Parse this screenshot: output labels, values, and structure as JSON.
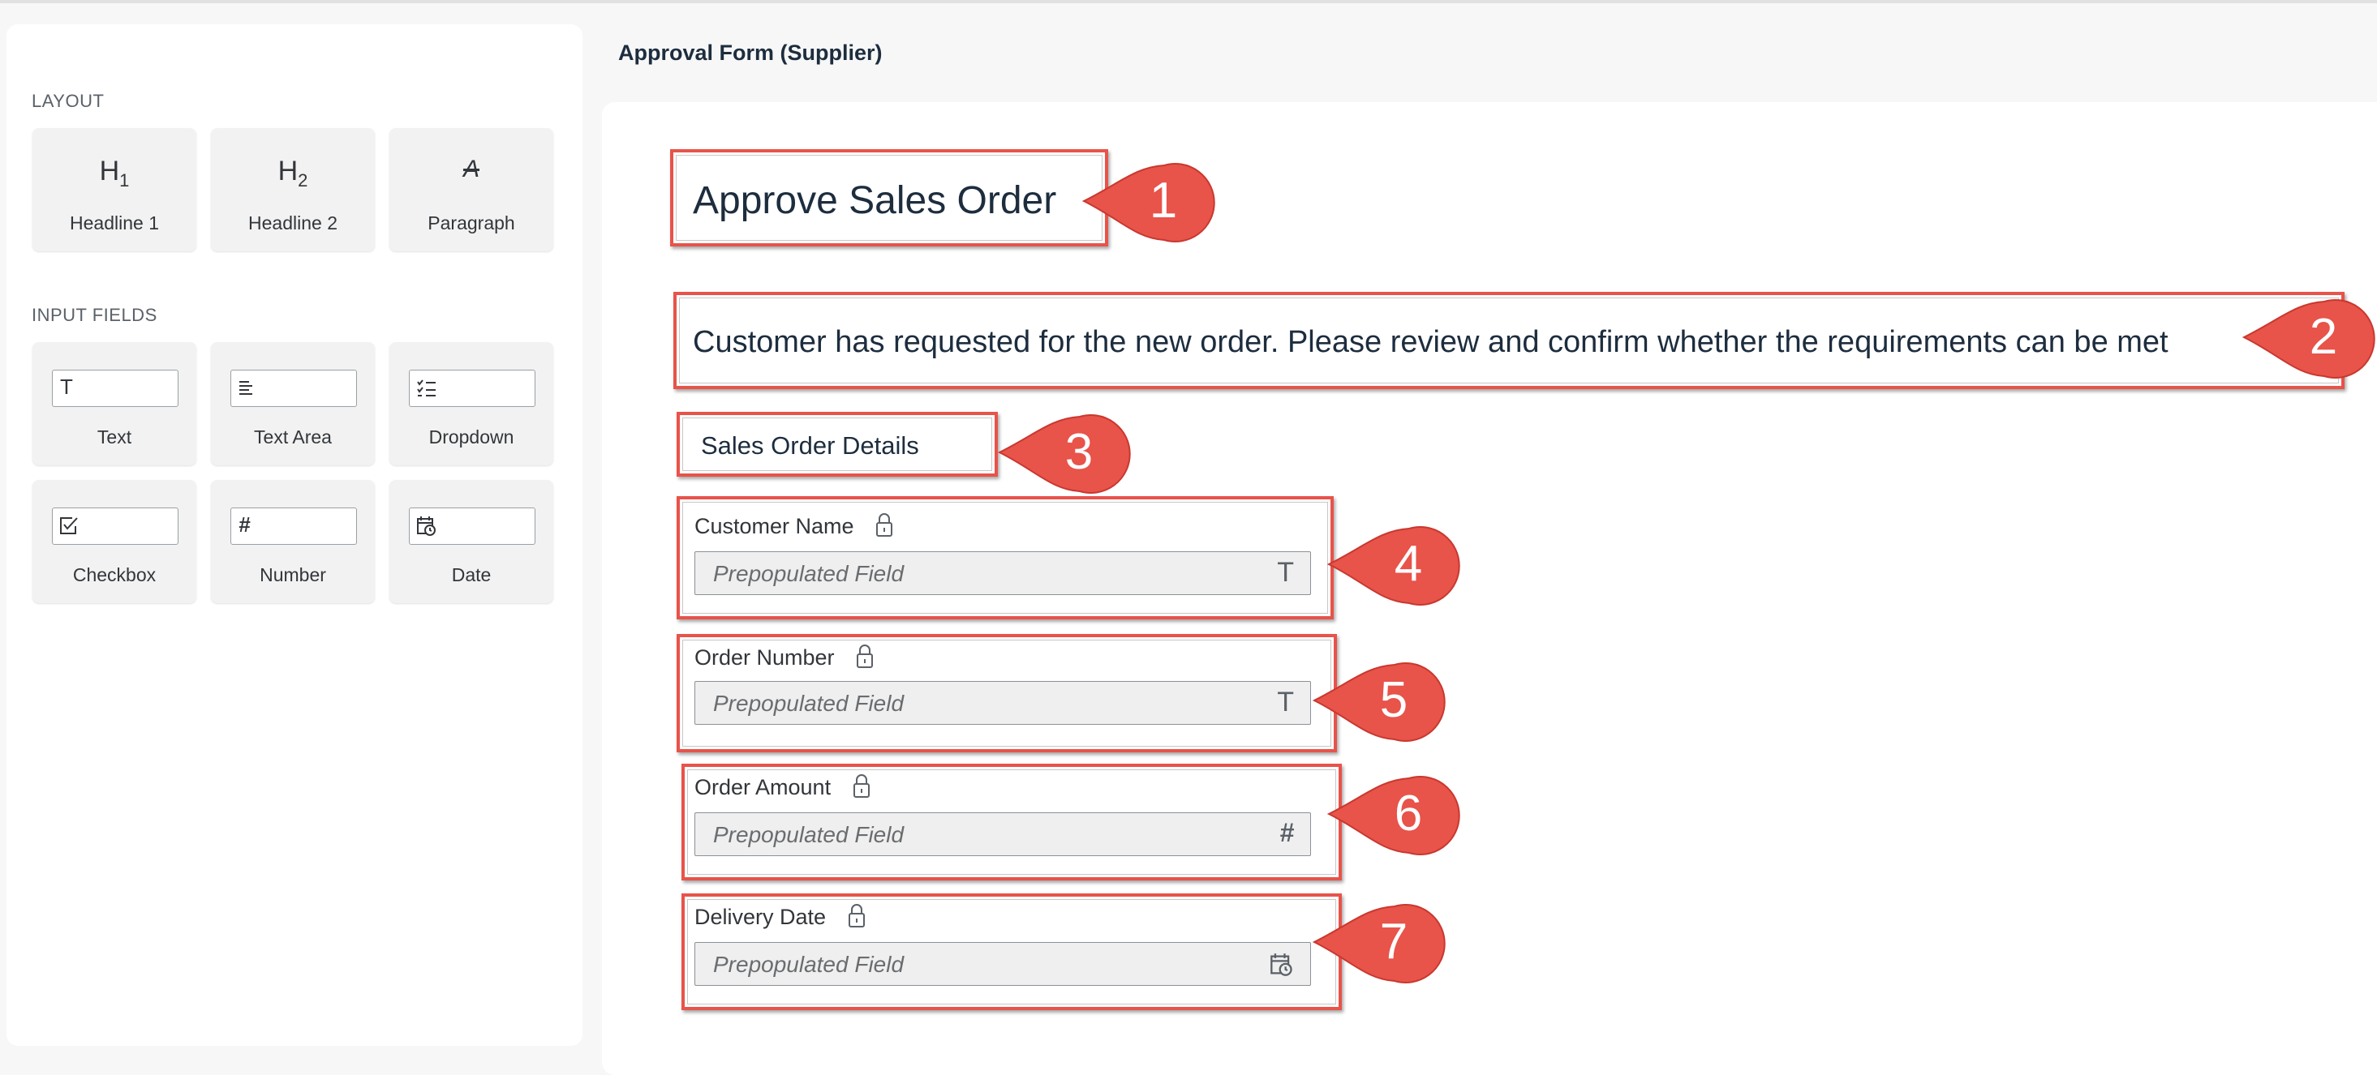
{
  "palette": {
    "layout_title": "LAYOUT",
    "layout_items": [
      {
        "label": "Headline 1",
        "icon": "headline-1-icon",
        "glyph": "H",
        "sub": "1"
      },
      {
        "label": "Headline 2",
        "icon": "headline-2-icon",
        "glyph": "H",
        "sub": "2"
      },
      {
        "label": "Paragraph",
        "icon": "paragraph-icon",
        "glyph": "A"
      }
    ],
    "input_title": "INPUT FIELDS",
    "input_items": [
      {
        "label": "Text",
        "icon": "text-icon",
        "glyph": "T"
      },
      {
        "label": "Text Area",
        "icon": "text-area-icon"
      },
      {
        "label": "Dropdown",
        "icon": "dropdown-icon"
      },
      {
        "label": "Checkbox",
        "icon": "checkbox-icon"
      },
      {
        "label": "Number",
        "icon": "number-icon",
        "glyph": "#"
      },
      {
        "label": "Date",
        "icon": "date-icon"
      }
    ]
  },
  "form": {
    "title": "Approval Form (Supplier)",
    "headline": "Approve Sales Order",
    "paragraph": "Customer has requested for the new order. Please review and confirm whether the requirements can be met",
    "section_heading": "Sales Order Details",
    "fields": [
      {
        "label": "Customer Name",
        "placeholder": "Prepopulated Field",
        "type_glyph": "T",
        "type_icon": "text-type-icon"
      },
      {
        "label": "Order Number",
        "placeholder": "Prepopulated Field",
        "type_glyph": "T",
        "type_icon": "text-type-icon"
      },
      {
        "label": "Order Amount",
        "placeholder": "Prepopulated Field",
        "type_glyph": "#",
        "type_icon": "number-type-icon"
      },
      {
        "label": "Delivery Date",
        "placeholder": "Prepopulated Field",
        "type_icon": "calendar-icon"
      }
    ]
  },
  "callouts": [
    "1",
    "2",
    "3",
    "4",
    "5",
    "6",
    "7"
  ],
  "colors": {
    "annotation_red": "#e8534a",
    "annotation_dark_red": "#c9382f",
    "tile_bg": "#f2f2f2",
    "field_bg": "#efefef",
    "text_dark": "#1d2d3e"
  }
}
